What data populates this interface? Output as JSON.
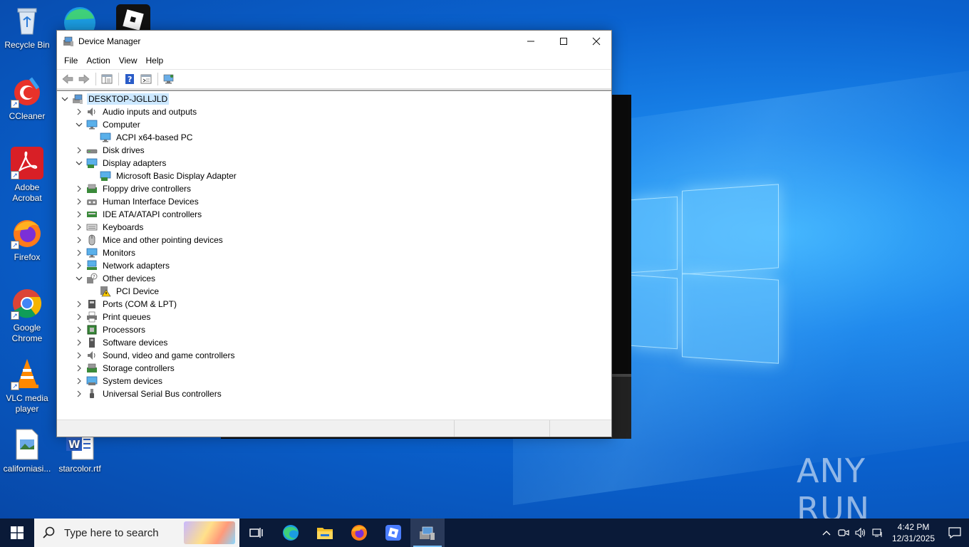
{
  "desktop": {
    "icons": [
      {
        "label": "Recycle Bin",
        "icon": "recycle-bin-icon"
      },
      {
        "label": "CCleaner",
        "icon": "ccleaner-icon"
      },
      {
        "label": "Adobe Acrobat",
        "icon": "adobe-acrobat-icon"
      },
      {
        "label": "Firefox",
        "icon": "firefox-icon"
      },
      {
        "label": "Google Chrome",
        "icon": "chrome-icon"
      },
      {
        "label": "VLC media player",
        "icon": "vlc-icon"
      },
      {
        "label": "californiasi...",
        "icon": "image-file-icon"
      },
      {
        "label": "starcolor.rtf",
        "icon": "word-document-icon"
      }
    ],
    "watermark": "ANY RUN"
  },
  "window": {
    "title": "Device Manager",
    "menu": [
      "File",
      "Action",
      "View",
      "Help"
    ],
    "toolbar": [
      "back-icon",
      "forward-icon",
      "show-hide-console-tree-icon",
      "help-icon",
      "properties-icon",
      "scan-hardware-icon"
    ],
    "tree": {
      "root": "DESKTOP-JGLLJLD",
      "categories": [
        {
          "label": "Audio inputs and outputs",
          "expanded": false,
          "icon": "speaker-icon",
          "children": []
        },
        {
          "label": "Computer",
          "expanded": true,
          "icon": "computer-icon",
          "children": [
            {
              "label": "ACPI x64-based PC",
              "icon": "monitor-icon"
            }
          ]
        },
        {
          "label": "Disk drives",
          "expanded": false,
          "icon": "disk-drive-icon",
          "children": []
        },
        {
          "label": "Display adapters",
          "expanded": true,
          "icon": "display-adapter-icon",
          "children": [
            {
              "label": "Microsoft Basic Display Adapter",
              "icon": "display-adapter-icon"
            }
          ]
        },
        {
          "label": "Floppy drive controllers",
          "expanded": false,
          "icon": "floppy-controller-icon",
          "children": []
        },
        {
          "label": "Human Interface Devices",
          "expanded": false,
          "icon": "hid-icon",
          "children": []
        },
        {
          "label": "IDE ATA/ATAPI controllers",
          "expanded": false,
          "icon": "ide-controller-icon",
          "children": []
        },
        {
          "label": "Keyboards",
          "expanded": false,
          "icon": "keyboard-icon",
          "children": []
        },
        {
          "label": "Mice and other pointing devices",
          "expanded": false,
          "icon": "mouse-icon",
          "children": []
        },
        {
          "label": "Monitors",
          "expanded": false,
          "icon": "monitor-icon",
          "children": []
        },
        {
          "label": "Network adapters",
          "expanded": false,
          "icon": "network-adapter-icon",
          "children": []
        },
        {
          "label": "Other devices",
          "expanded": true,
          "icon": "unknown-device-icon",
          "children": [
            {
              "label": "PCI Device",
              "icon": "warning-device-icon"
            }
          ]
        },
        {
          "label": "Ports (COM & LPT)",
          "expanded": false,
          "icon": "port-icon",
          "children": []
        },
        {
          "label": "Print queues",
          "expanded": false,
          "icon": "printer-icon",
          "children": []
        },
        {
          "label": "Processors",
          "expanded": false,
          "icon": "processor-icon",
          "children": []
        },
        {
          "label": "Software devices",
          "expanded": false,
          "icon": "software-device-icon",
          "children": []
        },
        {
          "label": "Sound, video and game controllers",
          "expanded": false,
          "icon": "speaker-icon",
          "children": []
        },
        {
          "label": "Storage controllers",
          "expanded": false,
          "icon": "storage-controller-icon",
          "children": []
        },
        {
          "label": "System devices",
          "expanded": false,
          "icon": "system-device-icon",
          "children": []
        },
        {
          "label": "Universal Serial Bus controllers",
          "expanded": false,
          "icon": "usb-icon",
          "children": []
        }
      ]
    }
  },
  "taskbar": {
    "search_placeholder": "Type here to search",
    "apps": [
      "task-view-icon",
      "edge-icon",
      "file-explorer-icon",
      "firefox-icon",
      "roblox-icon",
      "device-manager-icon"
    ],
    "clock": {
      "time": "4:42 PM",
      "date": "12/31/2025"
    }
  },
  "colors": {
    "selection": "#cce8ff",
    "taskbar": "#0a1a38",
    "desktop": "#0a6fd6"
  }
}
